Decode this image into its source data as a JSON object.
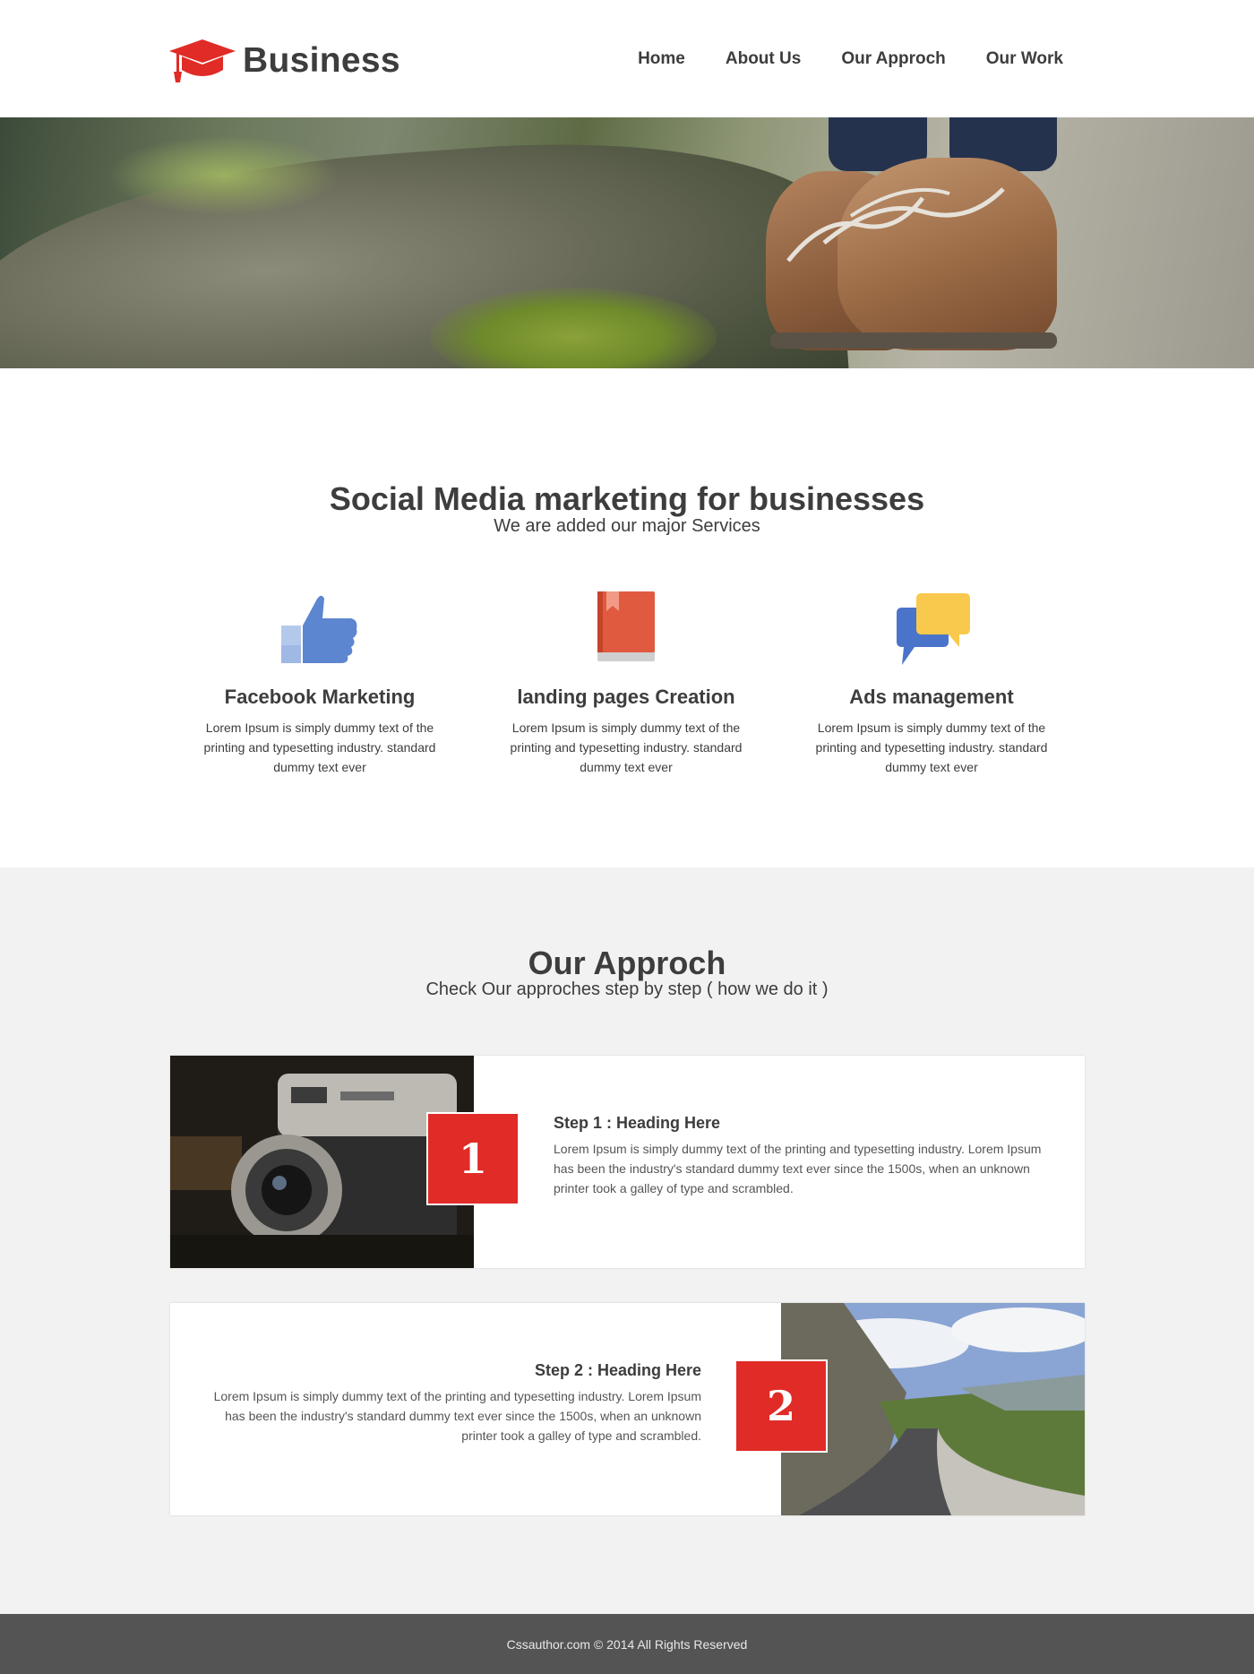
{
  "brand": {
    "name": "Business",
    "accent": "#e02b27",
    "logo_icon": "graduation-cap-icon"
  },
  "nav": {
    "items": [
      "Home",
      "About Us",
      "Our Approch",
      "Our Work"
    ]
  },
  "services": {
    "title": "Social Media marketing for businesses",
    "subtitle": "We are added our major Services",
    "items": [
      {
        "icon": "thumbs-up-icon",
        "title": "Facebook Marketing",
        "text": "Lorem Ipsum is simply dummy text of the printing and typesetting industry. standard dummy text ever"
      },
      {
        "icon": "book-icon",
        "title": "landing pages Creation",
        "text": "Lorem Ipsum is simply dummy text of the printing and typesetting industry. standard dummy text ever"
      },
      {
        "icon": "chat-bubbles-icon",
        "title": "Ads management",
        "text": "Lorem Ipsum is simply dummy text of the printing and typesetting industry. standard dummy text ever"
      }
    ]
  },
  "approach": {
    "title": "Our Approch",
    "subtitle": "Check Our approches step by step ( how we do it )",
    "steps": [
      {
        "number": "1",
        "heading": "Step 1 : Heading Here",
        "text": "Lorem Ipsum is simply dummy text of the printing and typesetting industry. Lorem Ipsum has been the industry's standard dummy text ever since the 1500s, when an unknown printer took a galley of type and scrambled."
      },
      {
        "number": "2",
        "heading": "Step 2 : Heading Here",
        "text": "Lorem Ipsum is simply dummy text of the printing and typesetting industry. Lorem Ipsum has been the industry's standard dummy text ever since the 1500s, when an unknown printer took a galley of type and scrambled."
      }
    ]
  },
  "footer": {
    "text": "Cssauthor.com © 2014 All Rights Reserved"
  }
}
